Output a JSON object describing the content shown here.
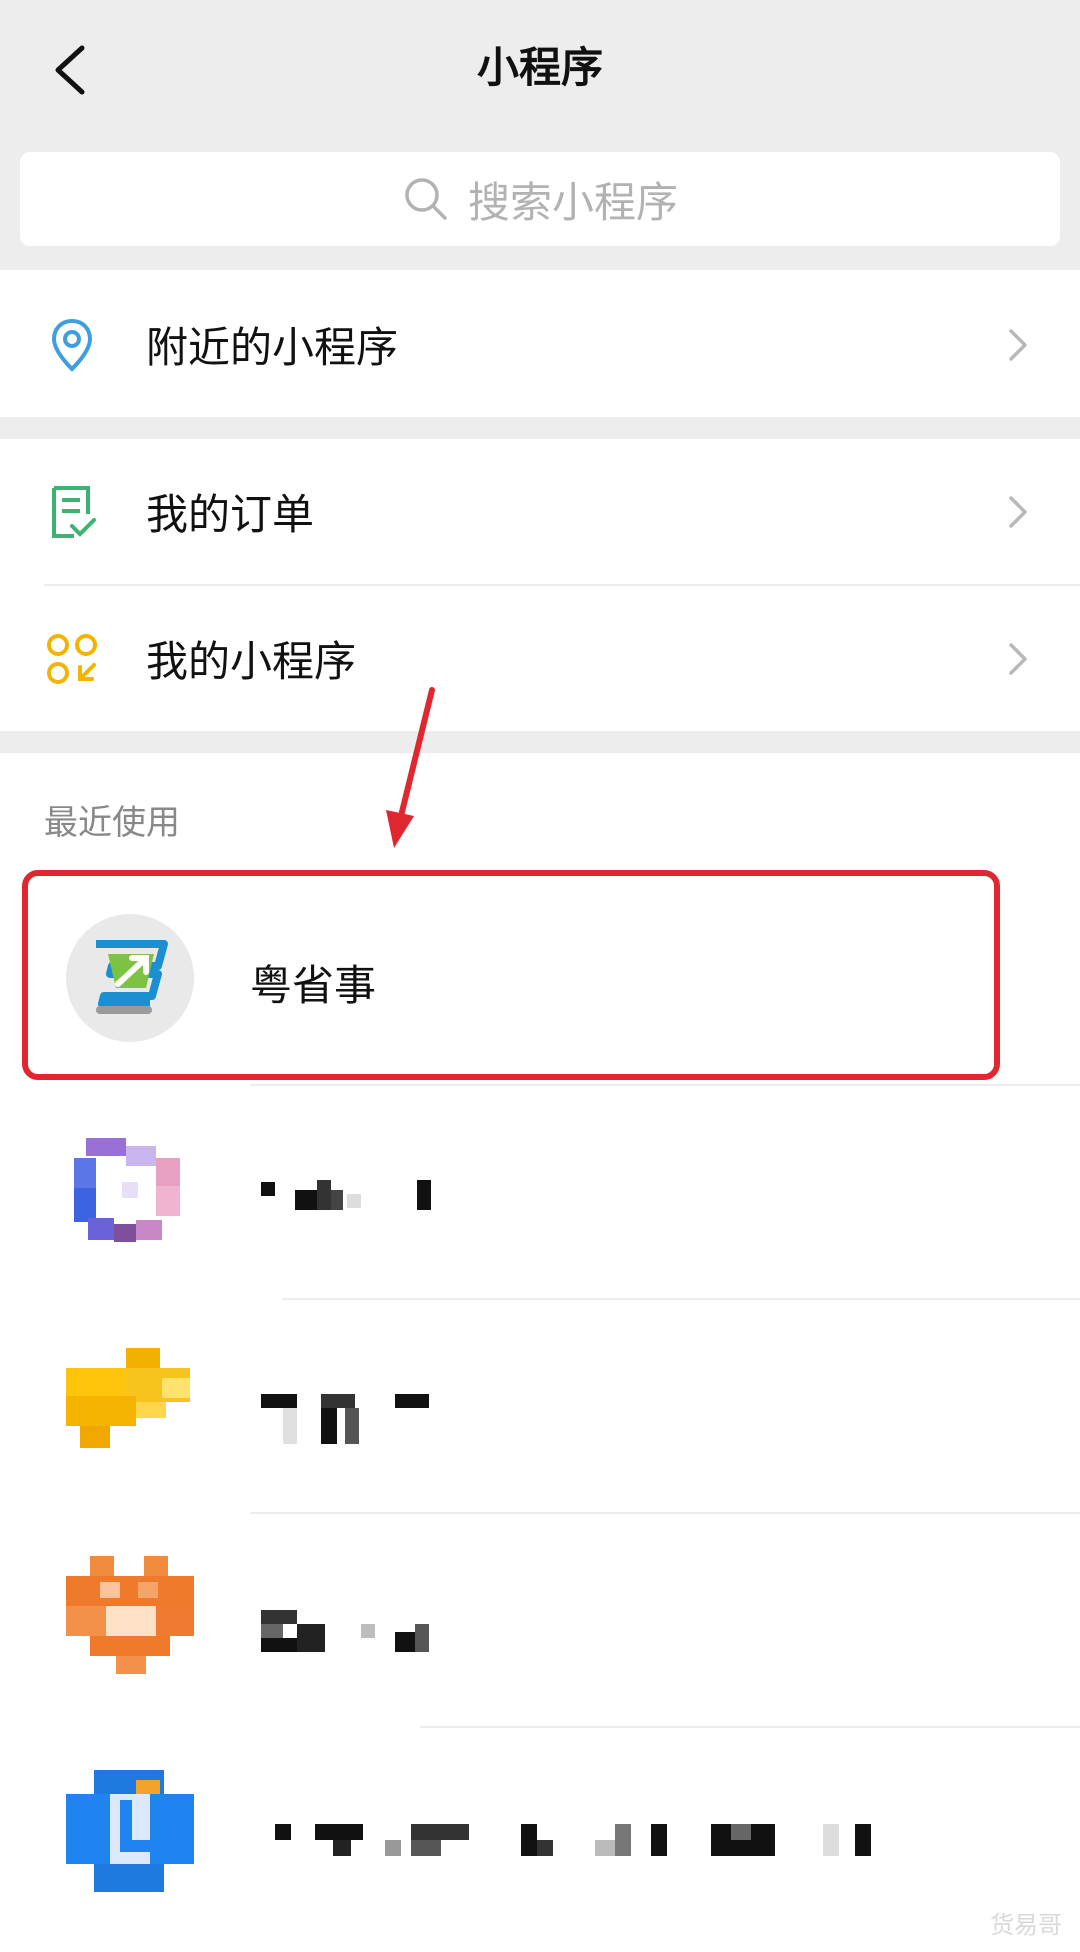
{
  "header": {
    "title": "小程序",
    "back_icon": "back-chevron-icon",
    "search_placeholder": "搜索小程序"
  },
  "menu": {
    "nearby": {
      "label": "附近的小程序",
      "icon": "location-pin-icon",
      "icon_color": "#3d9fe0"
    },
    "orders": {
      "label": "我的订单",
      "icon": "order-checklist-icon",
      "icon_color": "#3cb371"
    },
    "my_mini": {
      "label": "我的小程序",
      "icon": "mini-program-grid-icon",
      "icon_color": "#f2b400"
    }
  },
  "recent": {
    "section_label": "最近使用",
    "items": [
      {
        "name": "粤省事",
        "icon": "yueshengshi-logo-icon"
      }
    ]
  },
  "annotation": {
    "highlight_color": "#e0272f"
  },
  "watermark": "货易哥"
}
